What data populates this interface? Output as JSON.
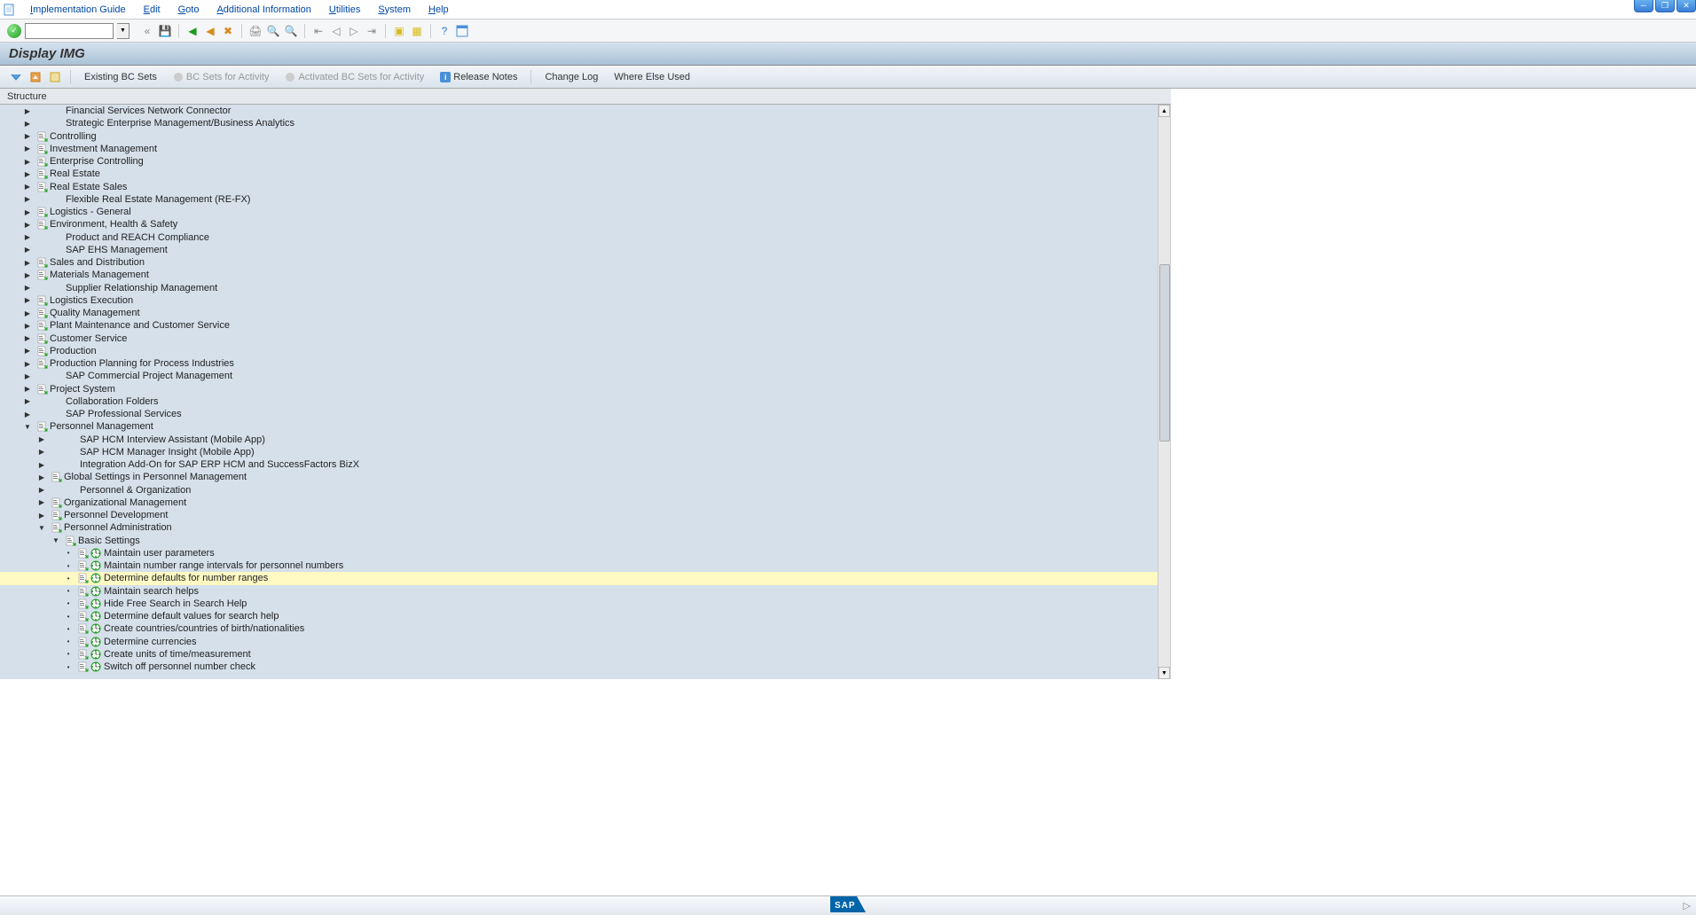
{
  "menubar": {
    "items": [
      {
        "label": "Implementation Guide",
        "underline": "I"
      },
      {
        "label": "Edit",
        "underline": "E"
      },
      {
        "label": "Goto",
        "underline": "G"
      },
      {
        "label": "Additional Information",
        "underline": "A"
      },
      {
        "label": "Utilities",
        "underline": "U"
      },
      {
        "label": "System",
        "underline": "S"
      },
      {
        "label": "Help",
        "underline": "H"
      }
    ]
  },
  "title": "Display IMG",
  "app_toolbar": {
    "existing_bc_sets": "Existing BC Sets",
    "bc_sets_activity": "BC Sets for Activity",
    "activated_bc_sets": "Activated BC Sets for Activity",
    "release_notes": "Release Notes",
    "change_log": "Change Log",
    "where_else_used": "Where Else Used"
  },
  "structure_label": "Structure",
  "tree": [
    {
      "level": 0,
      "exp": "closed",
      "doc": false,
      "exec": false,
      "label": "Financial Services Network Connector"
    },
    {
      "level": 0,
      "exp": "closed",
      "doc": false,
      "exec": false,
      "label": "Strategic Enterprise Management/Business Analytics"
    },
    {
      "level": 0,
      "exp": "closed",
      "doc": true,
      "exec": false,
      "label": "Controlling"
    },
    {
      "level": 0,
      "exp": "closed",
      "doc": true,
      "exec": false,
      "label": "Investment Management"
    },
    {
      "level": 0,
      "exp": "closed",
      "doc": true,
      "exec": false,
      "label": "Enterprise Controlling"
    },
    {
      "level": 0,
      "exp": "closed",
      "doc": true,
      "exec": false,
      "label": "Real Estate"
    },
    {
      "level": 0,
      "exp": "closed",
      "doc": true,
      "exec": false,
      "label": "Real Estate Sales"
    },
    {
      "level": 0,
      "exp": "closed",
      "doc": false,
      "exec": false,
      "label": "Flexible Real Estate Management (RE-FX)"
    },
    {
      "level": 0,
      "exp": "closed",
      "doc": true,
      "exec": false,
      "label": "Logistics - General"
    },
    {
      "level": 0,
      "exp": "closed",
      "doc": true,
      "exec": false,
      "label": "Environment, Health & Safety"
    },
    {
      "level": 0,
      "exp": "closed",
      "doc": false,
      "exec": false,
      "label": "Product and REACH Compliance"
    },
    {
      "level": 0,
      "exp": "closed",
      "doc": false,
      "exec": false,
      "label": "SAP EHS Management"
    },
    {
      "level": 0,
      "exp": "closed",
      "doc": true,
      "exec": false,
      "label": "Sales and Distribution"
    },
    {
      "level": 0,
      "exp": "closed",
      "doc": true,
      "exec": false,
      "label": "Materials Management"
    },
    {
      "level": 0,
      "exp": "closed",
      "doc": false,
      "exec": false,
      "label": "Supplier Relationship Management"
    },
    {
      "level": 0,
      "exp": "closed",
      "doc": true,
      "exec": false,
      "label": "Logistics Execution"
    },
    {
      "level": 0,
      "exp": "closed",
      "doc": true,
      "exec": false,
      "label": "Quality Management"
    },
    {
      "level": 0,
      "exp": "closed",
      "doc": true,
      "exec": false,
      "label": "Plant Maintenance and Customer Service"
    },
    {
      "level": 0,
      "exp": "closed",
      "doc": true,
      "exec": false,
      "label": "Customer Service"
    },
    {
      "level": 0,
      "exp": "closed",
      "doc": true,
      "exec": false,
      "label": "Production"
    },
    {
      "level": 0,
      "exp": "closed",
      "doc": true,
      "exec": false,
      "label": "Production Planning for Process Industries"
    },
    {
      "level": 0,
      "exp": "closed",
      "doc": false,
      "exec": false,
      "label": "SAP Commercial Project Management"
    },
    {
      "level": 0,
      "exp": "closed",
      "doc": true,
      "exec": false,
      "label": "Project System"
    },
    {
      "level": 0,
      "exp": "closed",
      "doc": false,
      "exec": false,
      "label": "Collaboration Folders"
    },
    {
      "level": 0,
      "exp": "closed",
      "doc": false,
      "exec": false,
      "label": "SAP Professional Services"
    },
    {
      "level": 0,
      "exp": "open",
      "doc": true,
      "exec": false,
      "label": "Personnel Management"
    },
    {
      "level": 1,
      "exp": "closed",
      "doc": false,
      "exec": false,
      "label": "SAP HCM Interview Assistant (Mobile App)"
    },
    {
      "level": 1,
      "exp": "closed",
      "doc": false,
      "exec": false,
      "label": "SAP HCM Manager Insight (Mobile App)"
    },
    {
      "level": 1,
      "exp": "closed",
      "doc": false,
      "exec": false,
      "label": "Integration Add-On for SAP ERP HCM and SuccessFactors BizX"
    },
    {
      "level": 1,
      "exp": "closed",
      "doc": true,
      "exec": false,
      "label": "Global Settings in Personnel Management"
    },
    {
      "level": 1,
      "exp": "closed",
      "doc": false,
      "exec": false,
      "label": "Personnel & Organization"
    },
    {
      "level": 1,
      "exp": "closed",
      "doc": true,
      "exec": false,
      "label": "Organizational Management"
    },
    {
      "level": 1,
      "exp": "closed",
      "doc": true,
      "exec": false,
      "label": "Personnel Development"
    },
    {
      "level": 1,
      "exp": "open",
      "doc": true,
      "exec": false,
      "label": "Personnel Administration"
    },
    {
      "level": 2,
      "exp": "open",
      "doc": true,
      "exec": false,
      "label": "Basic Settings"
    },
    {
      "level": 3,
      "exp": "leaf",
      "doc": true,
      "exec": true,
      "label": "Maintain user parameters"
    },
    {
      "level": 3,
      "exp": "leaf",
      "doc": true,
      "exec": true,
      "label": "Maintain number range intervals for personnel numbers"
    },
    {
      "level": 3,
      "exp": "leaf",
      "doc": true,
      "exec": true,
      "label": "Determine defaults for number ranges",
      "selected": true
    },
    {
      "level": 3,
      "exp": "leaf",
      "doc": true,
      "exec": true,
      "label": "Maintain search helps"
    },
    {
      "level": 3,
      "exp": "leaf",
      "doc": true,
      "exec": true,
      "label": "Hide Free Search in Search Help"
    },
    {
      "level": 3,
      "exp": "leaf",
      "doc": true,
      "exec": true,
      "label": "Determine default values for search help"
    },
    {
      "level": 3,
      "exp": "leaf",
      "doc": true,
      "exec": true,
      "label": "Create countries/countries of birth/nationalities"
    },
    {
      "level": 3,
      "exp": "leaf",
      "doc": true,
      "exec": true,
      "label": "Determine currencies"
    },
    {
      "level": 3,
      "exp": "leaf",
      "doc": true,
      "exec": true,
      "label": "Create units of time/measurement"
    },
    {
      "level": 3,
      "exp": "leaf",
      "doc": true,
      "exec": true,
      "label": "Switch off personnel number check"
    }
  ]
}
